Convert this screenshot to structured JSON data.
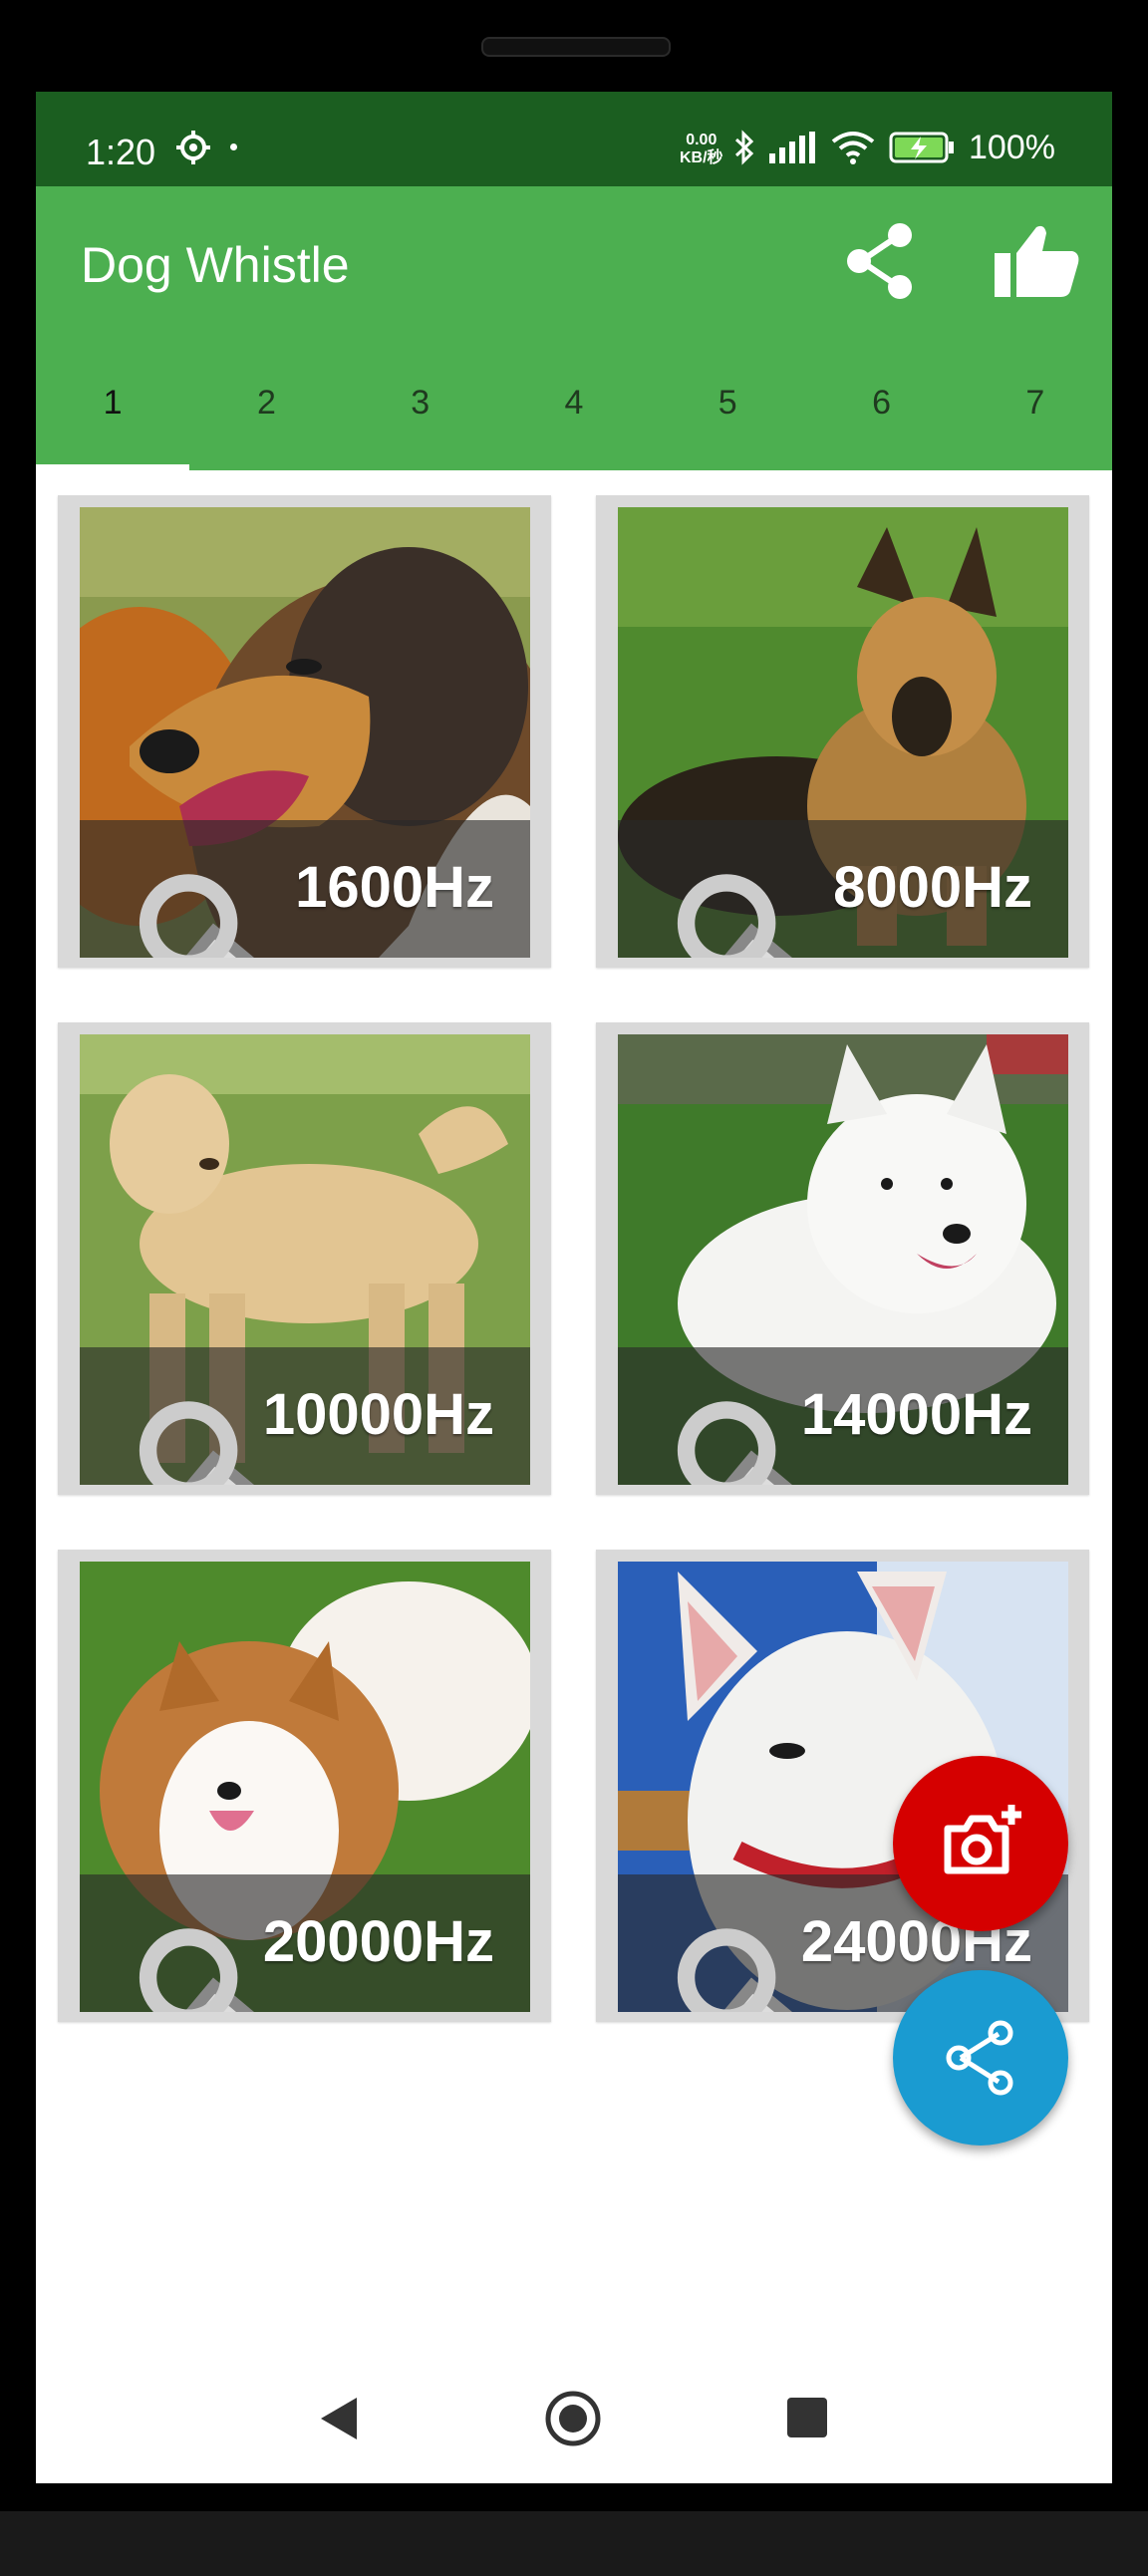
{
  "status_bar": {
    "time": "1:20",
    "speed_top": "0.00",
    "speed_bottom": "KB/秒",
    "battery": "100%"
  },
  "app_bar": {
    "title": "Dog Whistle",
    "share_icon": "share-icon",
    "like_icon": "thumbs-up-icon"
  },
  "tabs": [
    {
      "label": "1",
      "active": true
    },
    {
      "label": "2"
    },
    {
      "label": "3"
    },
    {
      "label": "4"
    },
    {
      "label": "5"
    },
    {
      "label": "6"
    },
    {
      "label": "7"
    }
  ],
  "cards": [
    {
      "frequency": "1600Hz",
      "dog": "rough collie"
    },
    {
      "frequency": "8000Hz",
      "dog": "german shepherd"
    },
    {
      "frequency": "10000Hz",
      "dog": "labrador retriever"
    },
    {
      "frequency": "14000Hz",
      "dog": "american eskimo dog"
    },
    {
      "frequency": "20000Hz",
      "dog": "pomeranian"
    },
    {
      "frequency": "24000Hz",
      "dog": "bull terrier"
    }
  ],
  "fabs": {
    "camera_icon": "add-photo-icon",
    "share_icon": "share-icon"
  },
  "colors": {
    "status_bar": "#1b5e20",
    "app_bar": "#4caf50",
    "fab_camera": "#d50000",
    "fab_share": "#1a9bd1"
  }
}
